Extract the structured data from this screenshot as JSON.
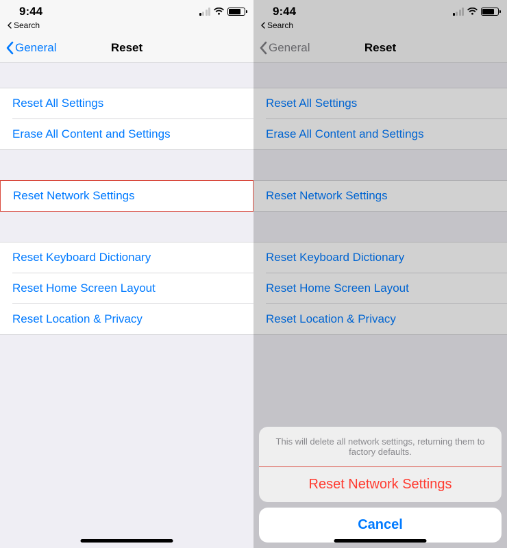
{
  "statusbar": {
    "time": "9:44"
  },
  "breadcrumb": {
    "label": "Search"
  },
  "nav": {
    "back": "General",
    "title": "Reset"
  },
  "groups": {
    "g1": {
      "reset_all": "Reset All Settings",
      "erase_all": "Erase All Content and Settings"
    },
    "g2": {
      "reset_network": "Reset Network Settings"
    },
    "g3": {
      "reset_keyboard": "Reset Keyboard Dictionary",
      "reset_home": "Reset Home Screen Layout",
      "reset_location": "Reset Location & Privacy"
    }
  },
  "sheet": {
    "message": "This will delete all network settings, returning them to factory defaults.",
    "action": "Reset Network Settings",
    "cancel": "Cancel"
  }
}
